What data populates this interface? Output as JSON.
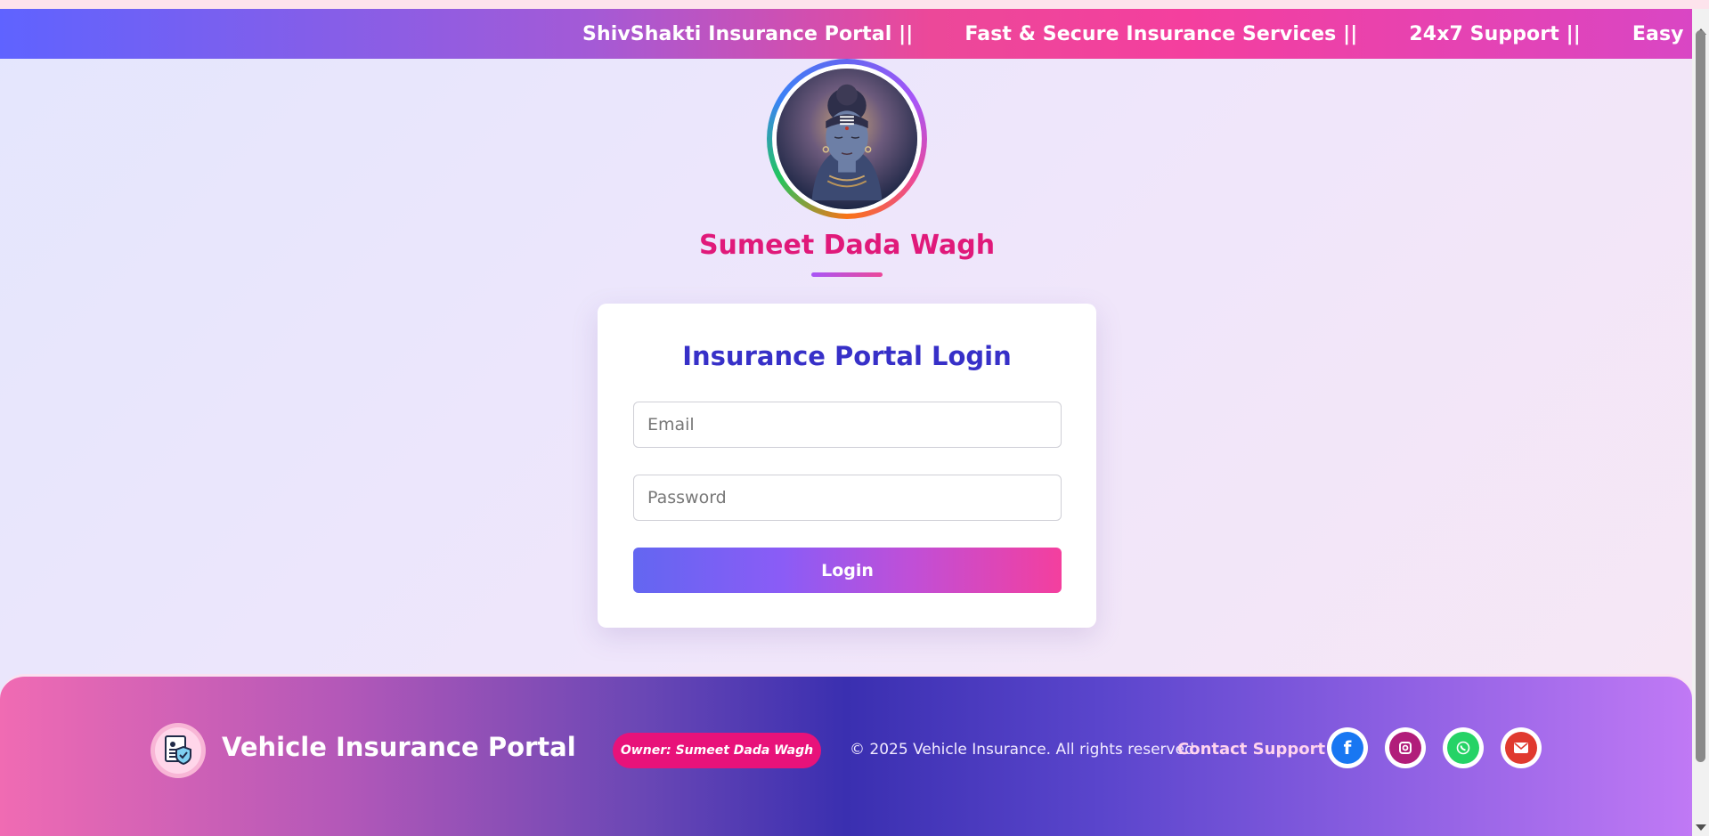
{
  "marquee": {
    "items": [
      "ShivShakti Insurance Portal ||",
      "Fast & Secure Insurance Services ||",
      "24x7 Support ||",
      "Easy Policy Managem"
    ]
  },
  "profile": {
    "name": "Sumeet Dada Wagh"
  },
  "login": {
    "title": "Insurance Portal Login",
    "email_placeholder": "Email",
    "password_placeholder": "Password",
    "button_label": "Login"
  },
  "footer": {
    "title": "Vehicle Insurance Portal",
    "owner_badge": "Owner: Sumeet Dada Wagh",
    "copyright": "© 2025 Vehicle Insurance. All rights reserved.",
    "contact_label": "Contact Support",
    "social": [
      {
        "icon": "facebook-icon",
        "color": "#1877f2"
      },
      {
        "icon": "instagram-icon",
        "color": "#b11d7a"
      },
      {
        "icon": "whatsapp-icon",
        "color": "#25d366"
      },
      {
        "icon": "email-icon",
        "color": "#e03a2f"
      }
    ]
  },
  "colors": {
    "accent_pink": "#e0197a",
    "title_indigo": "#3730c8",
    "gradient_start": "#6366f1",
    "gradient_end": "#f43f9e"
  }
}
